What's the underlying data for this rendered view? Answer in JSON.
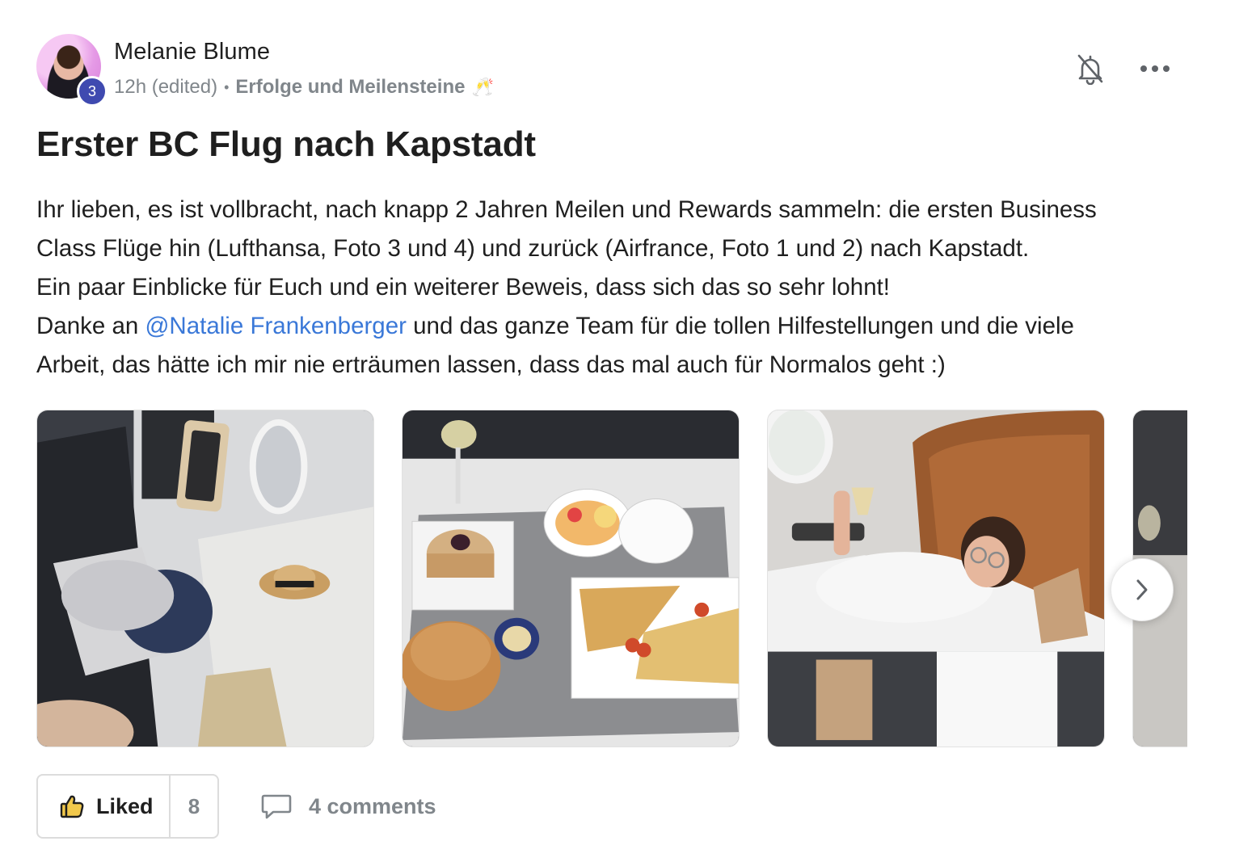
{
  "post": {
    "author": {
      "name": "Melanie Blume",
      "level": "3"
    },
    "meta": {
      "time": "12h (edited)",
      "separator": "•",
      "space": "Erfolge und Meilensteine",
      "space_emoji": "🥂"
    },
    "title": "Erster BC Flug nach Kapstadt",
    "body": {
      "line1": "Ihr lieben, es ist vollbracht, nach knapp 2 Jahren Meilen und Rewards sammeln: die ersten Business",
      "line2": "Class Flüge hin (Lufthansa, Foto 3 und 4) und zurück (Airfrance, Foto 1 und 2) nach Kapstadt.",
      "line3": "Ein paar Einblicke für Euch und ein weiterer Beweis, dass sich das so sehr lohnt!",
      "line4_before": "Danke an ",
      "mention": "@Natalie Frankenberger",
      "line4_after": " und das ganze Team für die tollen Hilfestellungen und die viele",
      "line5": "Arbeit, das hätte ich mir nie erträumen lassen, dass das mal auch für Normalos geht :)"
    },
    "gallery": {
      "photos": [
        {
          "icon": "airplane-seat-photo"
        },
        {
          "icon": "airplane-meal-photo"
        },
        {
          "icon": "passenger-toast-photo"
        },
        {
          "icon": "cabin-photo-partial"
        }
      ],
      "next_icon": "chevron-right-icon"
    },
    "actions": {
      "like_label": "Liked",
      "like_count": "8",
      "comments_label": "4 comments"
    },
    "icons": {
      "bell": "bell-off-icon",
      "more": "more-horizontal-icon",
      "like": "thumbs-up-icon",
      "comment": "comment-icon"
    },
    "colors": {
      "mention": "#3a78d8",
      "level_badge": "#3f4ab0",
      "muted_text": "#80868b"
    }
  }
}
